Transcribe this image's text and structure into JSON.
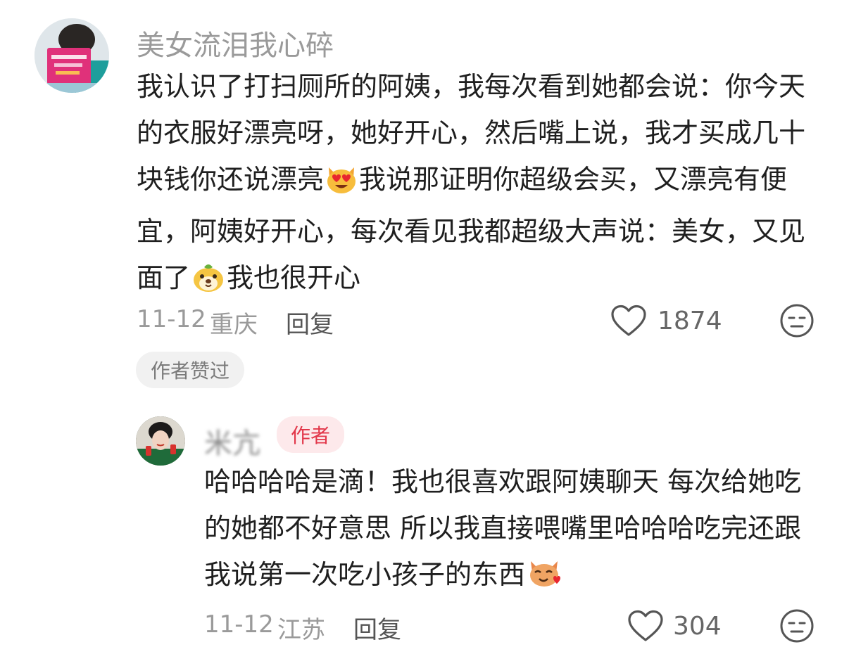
{
  "comment": {
    "username": "美女流泪我心碎",
    "body_parts": [
      "我认识了打扫厕所的阿姨，我每次看到她都会说：你今天的衣服好漂亮呀，她好开心，然后嘴上说，我才买成几十块钱你还说漂亮",
      "我说那证明你超级会买，又漂亮有便宜，阿姨好开心，每次看见我都超级大声说：美女，又见面了",
      "我也很开心"
    ],
    "emoji_1": "heart-eyes-cat-emoji",
    "emoji_2": "cartoon-dog-emoji",
    "date": "11-12",
    "location": "重庆",
    "reply_label": "回复",
    "like_count": "1874",
    "author_liked_label": "作者赞过"
  },
  "reply": {
    "username": "米亢",
    "author_badge": "作者",
    "body_parts": [
      "哈哈哈哈是滴！我也很喜欢跟阿姨聊天 每次给她吃的她都不好意思 所以我直接喂嘴里哈哈哈吃完还跟我说第一次吃小孩子的东西"
    ],
    "emoji_1": "cat-heart-emoji",
    "date": "11-12",
    "location": "江苏",
    "reply_label": "回复",
    "like_count": "304"
  },
  "colors": {
    "meta_gray": "#9a9a9a",
    "badge_red": "#e2374a",
    "badge_bg": "#fde9eb"
  }
}
